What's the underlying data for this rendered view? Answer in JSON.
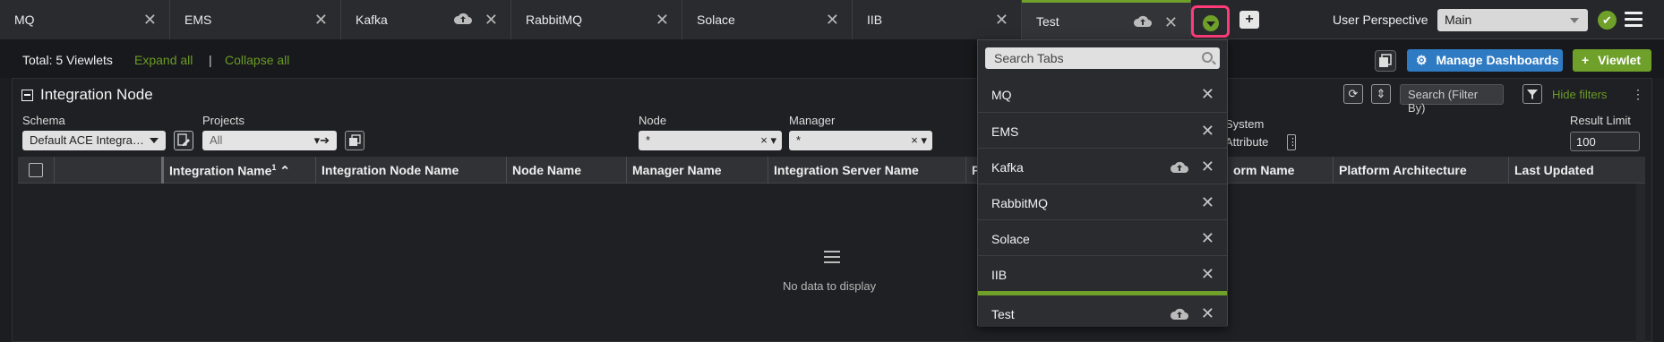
{
  "tabs": [
    {
      "label": "MQ",
      "cloud": false,
      "active": false
    },
    {
      "label": "EMS",
      "cloud": false,
      "active": false
    },
    {
      "label": "Kafka",
      "cloud": true,
      "active": false
    },
    {
      "label": "RabbitMQ",
      "cloud": false,
      "active": false
    },
    {
      "label": "Solace",
      "cloud": false,
      "active": false
    },
    {
      "label": "IIB",
      "cloud": false,
      "active": false
    },
    {
      "label": "Test",
      "cloud": true,
      "active": true
    }
  ],
  "header": {
    "perspective_label": "User Perspective",
    "perspective_value": "Main"
  },
  "toolbar": {
    "total": "Total: 5 Viewlets",
    "expand_all": "Expand all",
    "separator": "|",
    "collapse_all": "Collapse all",
    "manage_dashboards": "Manage Dashboards",
    "add_viewlet": "Viewlet"
  },
  "viewlet": {
    "title": "Integration Node",
    "filters": {
      "schema_label": "Schema",
      "schema_value": "Default ACE Integra…",
      "projects_label": "Projects",
      "projects_value": "All",
      "node_label": "Node",
      "node_value": "*",
      "manager_label": "Manager",
      "manager_value": "*",
      "system_label": "System",
      "attribute_label": "Attribute",
      "result_limit_label": "Result Limit",
      "result_limit_value": "100",
      "search_placeholder": "Search (Filter By)",
      "hide_filters": "Hide filters"
    },
    "columns": [
      "Integration Name",
      "Integration Node Name",
      "Node Name",
      "Manager Name",
      "Integration Server Name",
      "P",
      "orm Name",
      "Platform Architecture",
      "Last Updated"
    ],
    "sort_index": "1",
    "empty_text": "No data to display"
  },
  "tab_dropdown": {
    "search_placeholder": "Search Tabs",
    "items": [
      {
        "label": "MQ",
        "cloud": false
      },
      {
        "label": "EMS",
        "cloud": false
      },
      {
        "label": "Kafka",
        "cloud": true
      },
      {
        "label": "RabbitMQ",
        "cloud": false
      },
      {
        "label": "Solace",
        "cloud": false
      },
      {
        "label": "IIB",
        "cloud": false
      },
      {
        "label": "Test",
        "cloud": true,
        "active": true
      }
    ]
  },
  "colors": {
    "accent_green": "#6ea02a",
    "manage_blue": "#2f7bc3",
    "highlight_pink": "#ff3b7a"
  }
}
